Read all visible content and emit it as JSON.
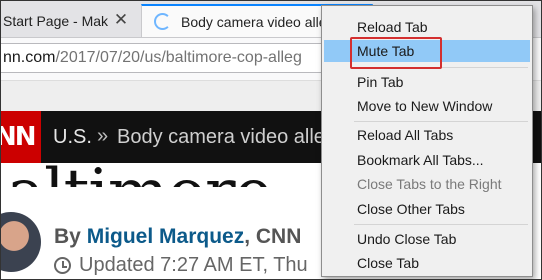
{
  "tabs": [
    {
      "title": "Start Page - Mak",
      "close_glyph": "✕"
    },
    {
      "title": "Body camera video alleg"
    }
  ],
  "address_bar": {
    "host": "nn.com",
    "path": "/2017/07/20/us/baltimore-cop-alleg"
  },
  "page": {
    "logo_text": "NN",
    "breadcrumb": {
      "section": "U.S.",
      "separator": "»",
      "title": "Body camera video alleg"
    },
    "headline_fragment": "altimore",
    "byline": {
      "prefix": "By",
      "author": "Miguel Marquez",
      "source": ", CNN"
    },
    "updated": "Updated 7:27 AM ET, Thu"
  },
  "context_menu": {
    "items": [
      {
        "label": "Reload Tab",
        "enabled": true
      },
      {
        "label": "Mute Tab",
        "enabled": true,
        "highlighted": true
      },
      {
        "label": "Pin Tab",
        "enabled": true
      },
      {
        "label": "Move to New Window",
        "enabled": true
      },
      {
        "label": "Reload All Tabs",
        "enabled": true
      },
      {
        "label": "Bookmark All Tabs...",
        "enabled": true
      },
      {
        "label": "Close Tabs to the Right",
        "enabled": false
      },
      {
        "label": "Close Other Tabs",
        "enabled": true
      },
      {
        "label": "Undo Close Tab",
        "enabled": true
      },
      {
        "label": "Close Tab",
        "enabled": true
      }
    ]
  },
  "colors": {
    "menu_highlight": "#91c9f7",
    "focus_outline": "#d32f2f",
    "cnn_red": "#cc0000",
    "author_link": "#0c5a8a"
  }
}
